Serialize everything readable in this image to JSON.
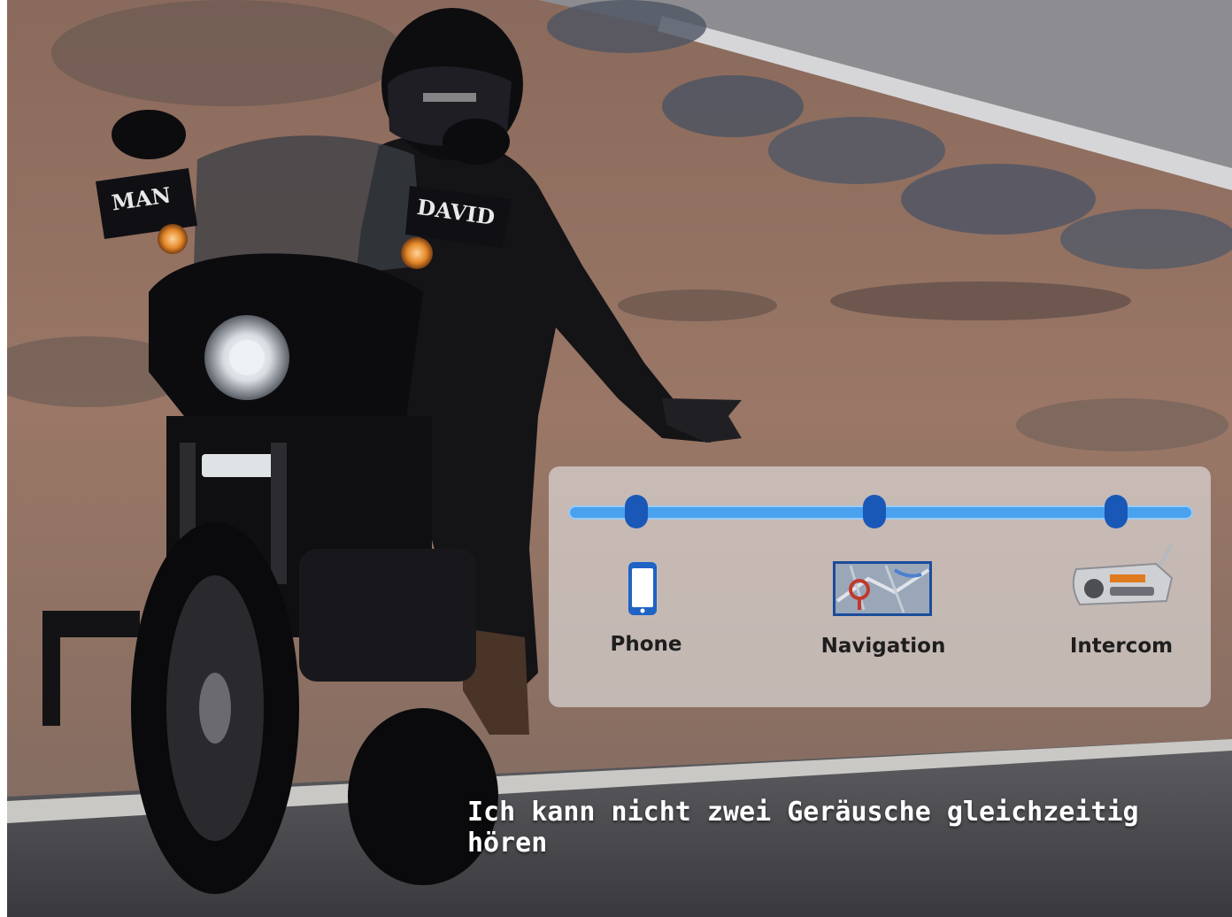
{
  "stages": [
    {
      "label": "Phone",
      "icon": "smartphone-icon"
    },
    {
      "label": "Navigation",
      "icon": "map-pin-icon"
    },
    {
      "label": "Intercom",
      "icon": "intercom-device-icon"
    }
  ],
  "bike": {
    "left_tag": "MAN",
    "right_tag": "DAVID"
  },
  "caption": "Ich kann nicht zwei Geräusche gleichzeitig hören",
  "colors": {
    "track": "#4aa1ee",
    "dot": "#1a58b8"
  }
}
